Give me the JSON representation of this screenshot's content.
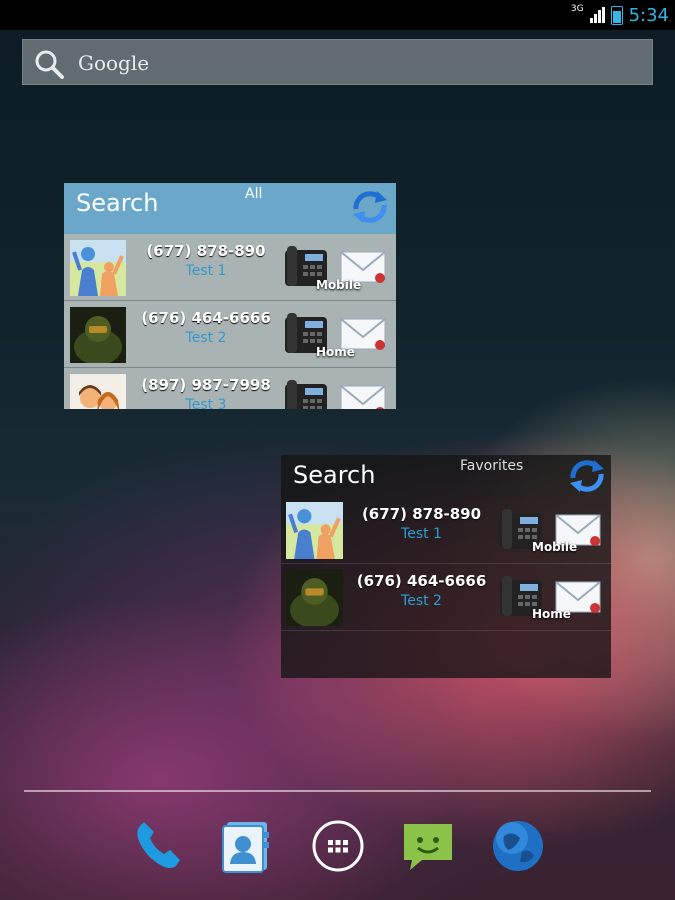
{
  "status_bar": {
    "network": "3G",
    "time": "5:34"
  },
  "google_search": {
    "label": "Google"
  },
  "widget_all": {
    "title": "Search",
    "filter": "All",
    "contacts": [
      {
        "phone": "(677) 878-890",
        "name": "Test 1",
        "type": "Mobile",
        "avatar": "friends-avatar-icon"
      },
      {
        "phone": "(676) 464-6666",
        "name": "Test 2",
        "type": "Home",
        "avatar": "soldier-avatar-icon"
      },
      {
        "phone": "(897) 987-7998",
        "name": "Test 3",
        "type": "",
        "avatar": "couple-avatar-icon"
      }
    ]
  },
  "widget_favorites": {
    "title": "Search",
    "filter": "Favorites",
    "contacts": [
      {
        "phone": "(677) 878-890",
        "name": "Test 1",
        "type": "Mobile",
        "avatar": "friends-avatar-icon"
      },
      {
        "phone": "(676) 464-6666",
        "name": "Test 2",
        "type": "Home",
        "avatar": "soldier-avatar-icon"
      }
    ]
  },
  "dock": [
    {
      "name": "phone-app-icon"
    },
    {
      "name": "contacts-app-icon"
    },
    {
      "name": "all-apps-icon"
    },
    {
      "name": "messaging-app-icon"
    },
    {
      "name": "browser-app-icon"
    }
  ],
  "colors": {
    "accent": "#33b5e5",
    "widget_header": "#6aa7c8",
    "link": "#2a9fd6"
  }
}
